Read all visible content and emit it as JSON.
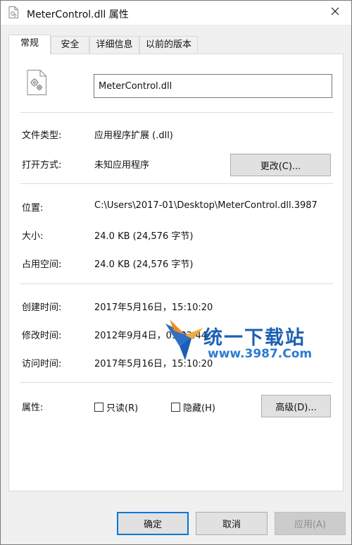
{
  "window": {
    "title": "MeterControl.dll 属性",
    "close_icon": "close-icon"
  },
  "tabs": [
    {
      "label": "常规",
      "active": true
    },
    {
      "label": "安全",
      "active": false
    },
    {
      "label": "详细信息",
      "active": false
    },
    {
      "label": "以前的版本",
      "active": false
    }
  ],
  "general": {
    "file_icon": "dll-file-icon",
    "file_name": "MeterControl.dll",
    "file_type_label": "文件类型:",
    "file_type_value": "应用程序扩展 (.dll)",
    "opens_with_label": "打开方式:",
    "opens_with_value": "未知应用程序",
    "change_button": "更改(C)...",
    "location_label": "位置:",
    "location_value": "C:\\Users\\2017-01\\Desktop\\MeterControl.dll.3987",
    "size_label": "大小:",
    "size_value": "24.0 KB (24,576 字节)",
    "size_on_disk_label": "占用空间:",
    "size_on_disk_value": "24.0 KB (24,576 字节)",
    "created_label": "创建时间:",
    "created_value": "2017年5月16日，15:10:20",
    "modified_label": "修改时间:",
    "modified_value": "2012年9月4日，09:32:44",
    "accessed_label": "访问时间:",
    "accessed_value": "2017年5月16日，15:10:20",
    "attributes_label": "属性:",
    "readonly_label": "只读(R)",
    "readonly_checked": false,
    "hidden_label": "隐藏(H)",
    "hidden_checked": false,
    "advanced_button": "高级(D)..."
  },
  "watermark": {
    "title": "统一下载站",
    "url": "www.3987.Com"
  },
  "footer": {
    "ok_button": "确定",
    "cancel_button": "取消",
    "apply_button": "应用(A)",
    "apply_disabled": true
  },
  "colors": {
    "accent": "#0078d7",
    "separator": "#dcdcdc",
    "watermark_blue": "#1b5fb4",
    "watermark_orange": "#f08a1c"
  }
}
